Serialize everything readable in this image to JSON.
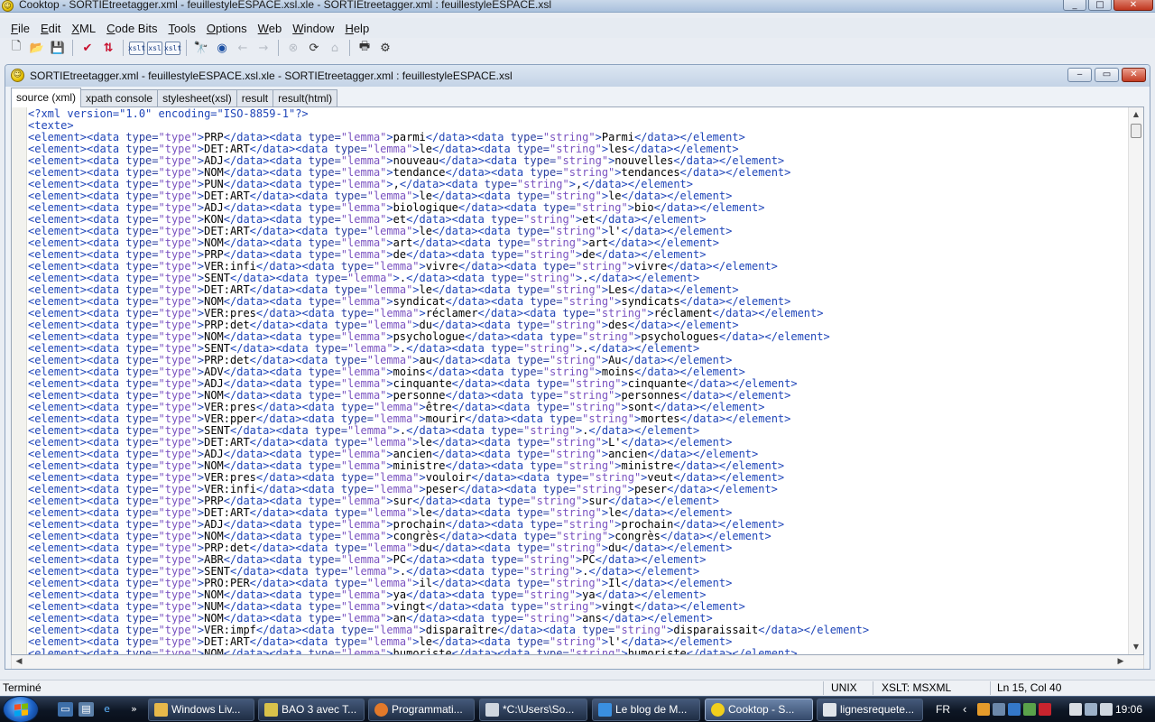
{
  "window": {
    "title": "Cooktop - SORTIEtreetagger.xml - feuillestyleESPACE.xsl.xle - SORTIEtreetagger.xml : feuillestyleESPACE.xsl",
    "min": "_",
    "max": "□",
    "close": "✕"
  },
  "menu": {
    "items": [
      {
        "ul": "F",
        "rest": "ile"
      },
      {
        "ul": "E",
        "rest": "dit"
      },
      {
        "ul": "X",
        "rest": "ML"
      },
      {
        "ul": "C",
        "rest": "ode Bits"
      },
      {
        "ul": "T",
        "rest": "ools"
      },
      {
        "ul": "O",
        "rest": "ptions"
      },
      {
        "ul": "W",
        "rest": "eb"
      },
      {
        "ul": "W",
        "rest": "indow"
      },
      {
        "ul": "H",
        "rest": "elp"
      }
    ]
  },
  "toolbar": {
    "new": "🗋",
    "open": "📂",
    "save": "💾",
    "check": "✔",
    "sort": "⇅",
    "xslt1": "xslt",
    "xslt2": "xsl",
    "xslt3": "xslt",
    "find": "🔭",
    "browse": "◉",
    "back": "←",
    "forward": "→",
    "stop": "⊗",
    "refresh": "⟳",
    "home": "⌂",
    "print": "🖶",
    "props": "⚙"
  },
  "doc": {
    "title": "SORTIEtreetagger.xml - feuillestyleESPACE.xsl.xle - SORTIEtreetagger.xml : feuillestyleESPACE.xsl",
    "min": "‒",
    "max": "▭",
    "close": "✕"
  },
  "tabs": [
    "source (xml)",
    "xpath console",
    "stylesheet(xsl)",
    "result",
    "result(html)"
  ],
  "xml": {
    "decl": "<?xml version=\"1.0\" encoding=\"ISO-8859-1\"?>",
    "root": "<texte>",
    "rows": [
      [
        "PRP",
        "parmi",
        "Parmi"
      ],
      [
        "DET:ART",
        "le",
        "les"
      ],
      [
        "ADJ",
        "nouveau",
        "nouvelles"
      ],
      [
        "NOM",
        "tendance",
        "tendances"
      ],
      [
        "PUN",
        ",",
        ","
      ],
      [
        "DET:ART",
        "le",
        "le"
      ],
      [
        "ADJ",
        "biologique",
        "bio"
      ],
      [
        "KON",
        "et",
        "et"
      ],
      [
        "DET:ART",
        "le",
        "l'"
      ],
      [
        "NOM",
        "art",
        "art"
      ],
      [
        "PRP",
        "de",
        "de"
      ],
      [
        "VER:infi",
        "vivre",
        "vivre"
      ],
      [
        "SENT",
        ".",
        "."
      ],
      [
        "DET:ART",
        "le",
        "Les"
      ],
      [
        "NOM",
        "syndicat",
        "syndicats"
      ],
      [
        "VER:pres",
        "réclamer",
        "réclament"
      ],
      [
        "PRP:det",
        "du",
        "des"
      ],
      [
        "NOM",
        "psychologue",
        "psychologues"
      ],
      [
        "SENT",
        ".",
        "."
      ],
      [
        "PRP:det",
        "au",
        "Au"
      ],
      [
        "ADV",
        "moins",
        "moins"
      ],
      [
        "ADJ",
        "cinquante",
        "cinquante"
      ],
      [
        "NOM",
        "personne",
        "personnes"
      ],
      [
        "VER:pres",
        "être",
        "sont"
      ],
      [
        "VER:pper",
        "mourir",
        "mortes"
      ],
      [
        "SENT",
        ".",
        "."
      ],
      [
        "DET:ART",
        "le",
        "L'"
      ],
      [
        "ADJ",
        "ancien",
        "ancien"
      ],
      [
        "NOM",
        "ministre",
        "ministre"
      ],
      [
        "VER:pres",
        "vouloir",
        "veut"
      ],
      [
        "VER:infi",
        "peser",
        "peser"
      ],
      [
        "PRP",
        "sur",
        "sur"
      ],
      [
        "DET:ART",
        "le",
        "le"
      ],
      [
        "ADJ",
        "prochain",
        "prochain"
      ],
      [
        "NOM",
        "congrès",
        "congrès"
      ],
      [
        "PRP:det",
        "du",
        "du"
      ],
      [
        "ABR",
        "PC",
        "PC"
      ],
      [
        "SENT",
        ".",
        "."
      ],
      [
        "PRO:PER",
        "il",
        "Il"
      ],
      [
        "NOM",
        "ya",
        "ya"
      ],
      [
        "NUM",
        "vingt",
        "vingt"
      ],
      [
        "NOM",
        "an",
        "ans"
      ],
      [
        "VER:impf",
        "disparaître",
        "disparaissait"
      ],
      [
        "DET:ART",
        "le",
        "l'"
      ],
      [
        "NOM",
        "humoriste",
        "humoriste"
      ]
    ]
  },
  "status": {
    "left": "Terminé",
    "lineend": "UNIX",
    "engine": "XSLT: MSXML",
    "pos": "Ln 15, Col 40"
  },
  "taskbar": {
    "items": [
      {
        "label": "Windows Liv...",
        "color": "#e7b84a"
      },
      {
        "label": "BAO 3 avec T...",
        "color": "#d9c24a"
      },
      {
        "label": "Programmati...",
        "color": "#e2792a"
      },
      {
        "label": "*C:\\Users\\So...",
        "color": "#cfd6df"
      },
      {
        "label": "Le blog de M...",
        "color": "#3a8fe0"
      },
      {
        "label": "Cooktop - S...",
        "color": "#f1cf1c"
      },
      {
        "label": "lignesrequete...",
        "color": "#dfe4ea"
      }
    ],
    "lang": "FR",
    "clock": "19:06",
    "more": "»"
  }
}
